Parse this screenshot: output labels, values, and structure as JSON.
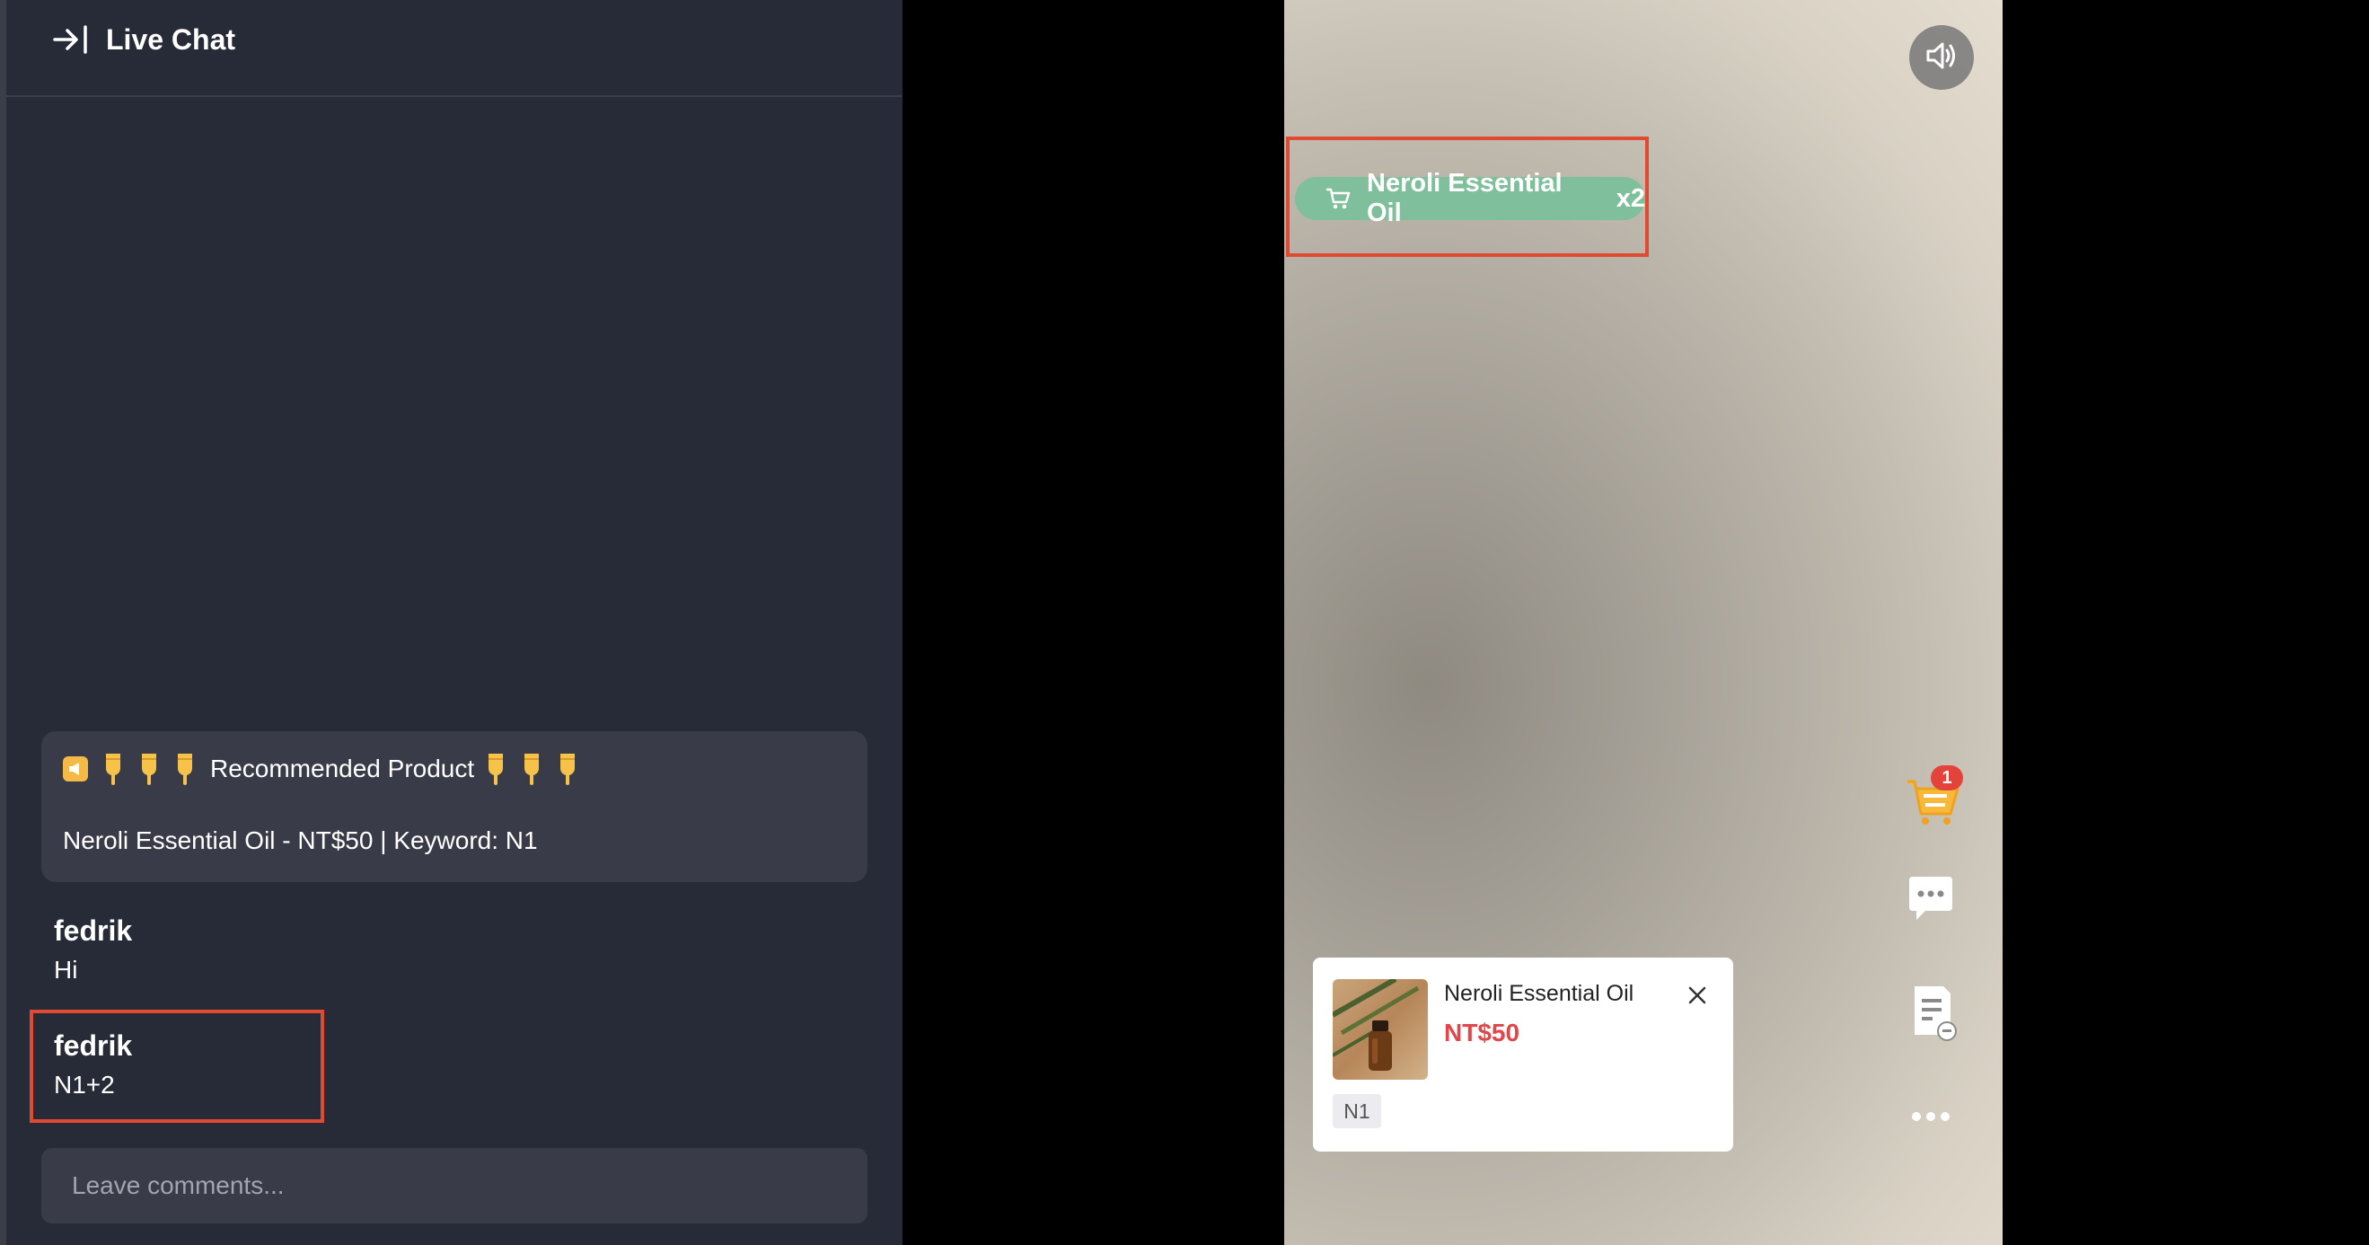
{
  "chat": {
    "title": "Live Chat",
    "pinned": {
      "heading": "Recommended Product",
      "body": "Neroli Essential Oil - NT$50 | Keyword: N1"
    },
    "messages": [
      {
        "user": "fedrik",
        "text": "Hi"
      },
      {
        "user": "fedrik",
        "text": "N1+2"
      }
    ],
    "input_placeholder": "Leave comments..."
  },
  "video": {
    "cart_tag": {
      "product": "Neroli Essential Oil",
      "quantity": "x2"
    },
    "cart_badge": "1",
    "product_card": {
      "name": "Neroli Essential Oil",
      "price": "NT$50",
      "keyword": "N1"
    }
  },
  "colors": {
    "highlight": "#e04a30",
    "cart_pill": "#7fbf9c",
    "price": "#e0474a",
    "badge": "#e3433b"
  },
  "icons": [
    "collapse-icon",
    "megaphone-icon",
    "pointing-down-icon",
    "volume-icon",
    "cart-icon",
    "chat-bubble-icon",
    "orders-icon",
    "more-icon",
    "close-icon"
  ]
}
